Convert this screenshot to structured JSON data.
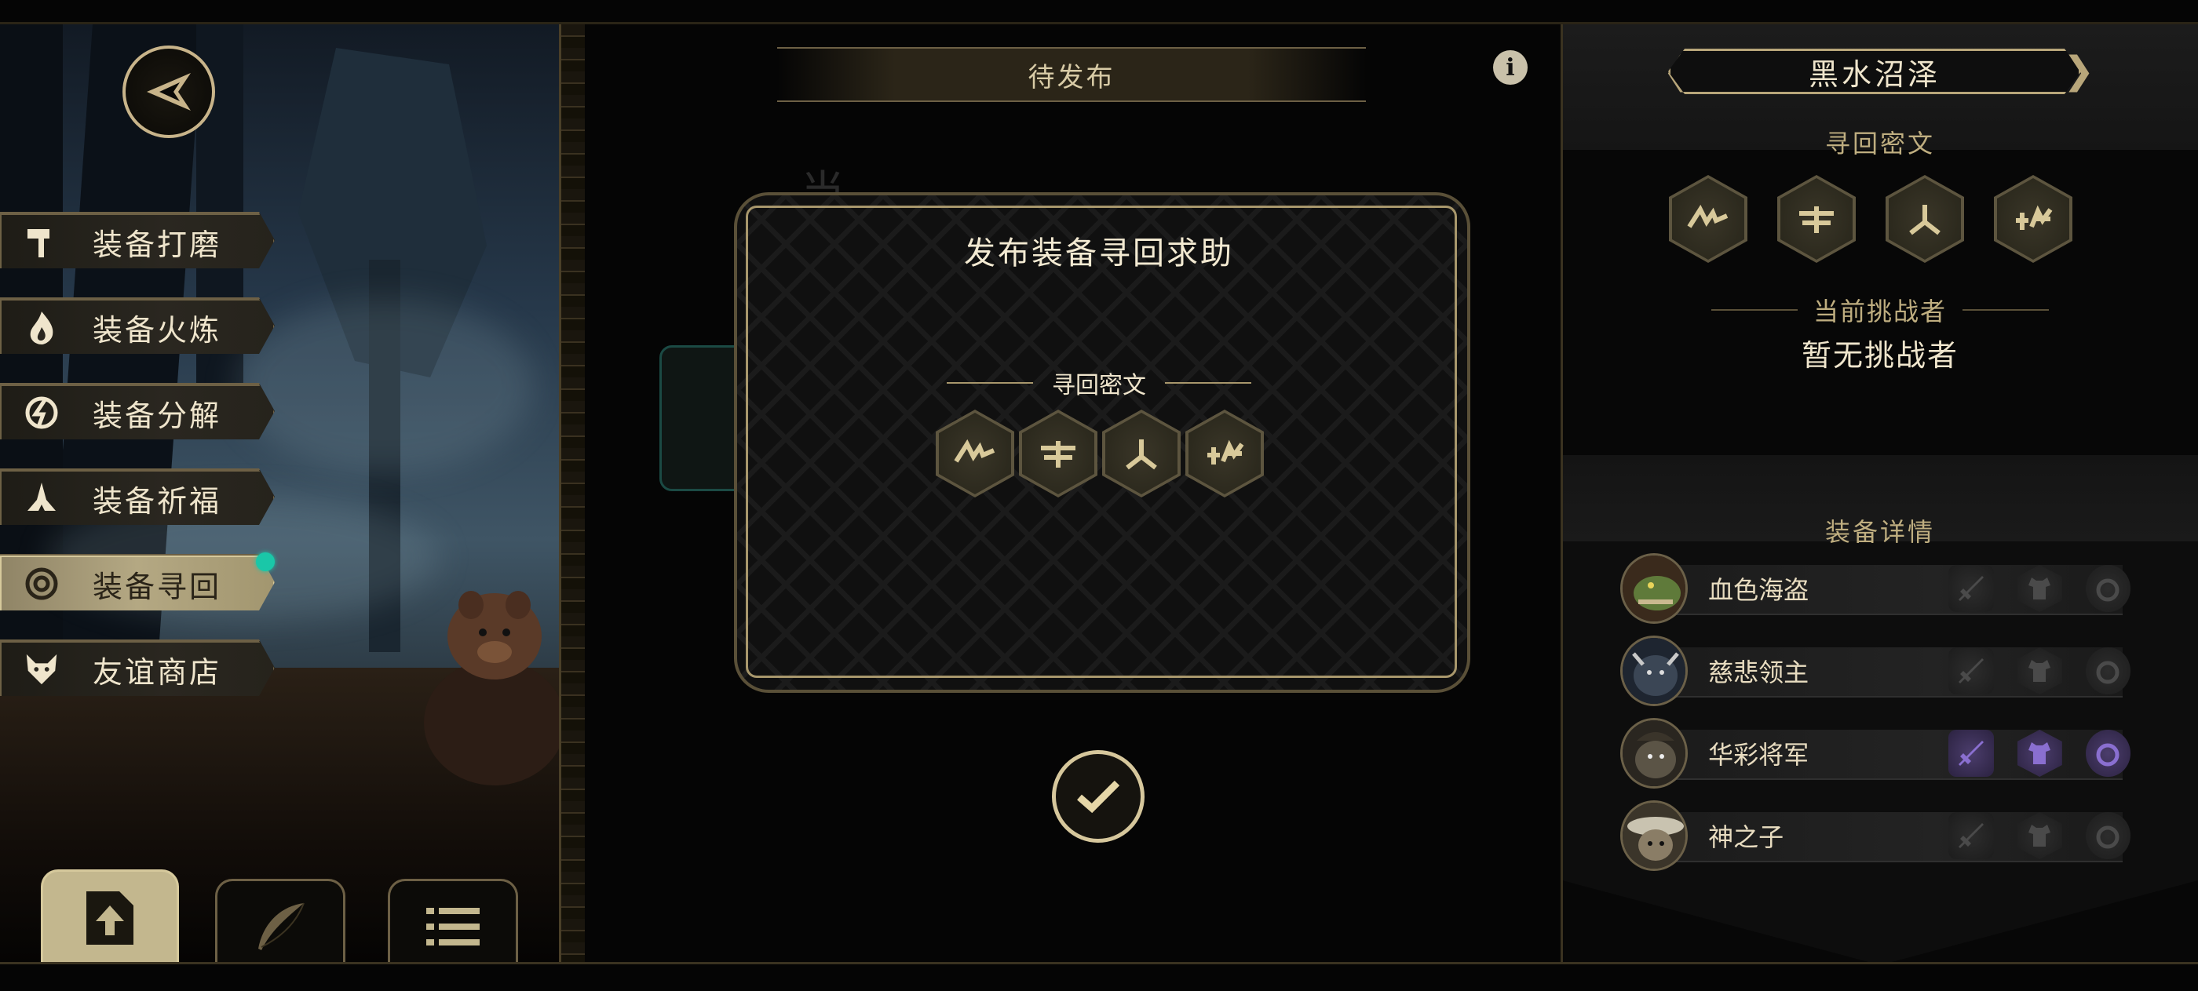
{
  "menu": [
    {
      "label": "装备打磨",
      "icon": "hammer-icon",
      "active": false
    },
    {
      "label": "装备火炼",
      "icon": "flame-icon",
      "active": false
    },
    {
      "label": "装备分解",
      "icon": "decompose-icon",
      "active": false
    },
    {
      "label": "装备祈福",
      "icon": "pray-hands-icon",
      "active": false
    },
    {
      "label": "装备寻回",
      "icon": "target-icon",
      "active": true
    },
    {
      "label": "友谊商店",
      "icon": "fox-head-icon",
      "active": false
    }
  ],
  "bottom_tabs": [
    {
      "icon": "upload-document-icon",
      "active": true
    },
    {
      "icon": "feather-icon",
      "active": false
    },
    {
      "icon": "list-icon",
      "active": false
    }
  ],
  "center": {
    "header": "待发布",
    "background_title": "当",
    "dialog": {
      "title": "发布装备寻回求助",
      "subtitle": "寻回密文",
      "runes": [
        "rune-1-icon",
        "rune-2-icon",
        "rune-3-icon",
        "rune-4-icon"
      ]
    }
  },
  "right": {
    "region": "黑水沼泽",
    "cipher_label": "寻回密文",
    "challenger_label": "当前挑战者",
    "challenger_value": "暂无挑战者",
    "details_label": "装备详情",
    "players": [
      {
        "name": "血色海盗",
        "avatar": "crocodile-avatar",
        "gear_active": false
      },
      {
        "name": "慈悲领主",
        "avatar": "beast-avatar",
        "gear_active": false
      },
      {
        "name": "华彩将军",
        "avatar": "general-avatar",
        "gear_active": true
      },
      {
        "name": "神之子",
        "avatar": "child-avatar",
        "gear_active": false
      }
    ]
  },
  "colors": {
    "accent_gold": "#c8b48a",
    "badge_teal": "#1ac7a8",
    "gear_purple": "#4b3d6c"
  }
}
